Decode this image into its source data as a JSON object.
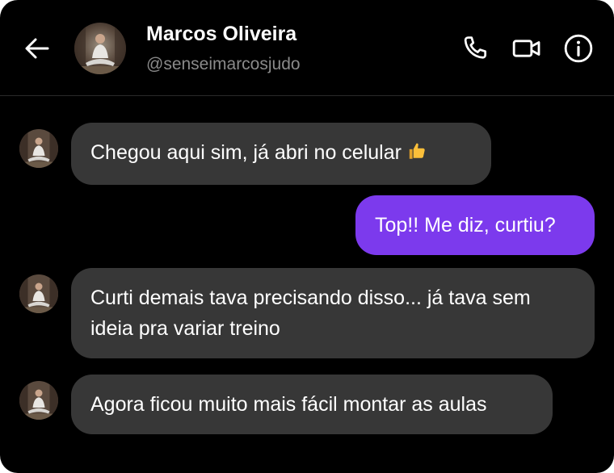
{
  "header": {
    "back_icon": "arrow-left-icon",
    "contact_name": "Marcos Oliveira",
    "contact_handle": "@senseimarcosjudo",
    "avatar": "avatar-photo-meditating-person",
    "actions": [
      {
        "icon": "phone-icon"
      },
      {
        "icon": "video-camera-icon"
      },
      {
        "icon": "info-icon"
      }
    ]
  },
  "messages": [
    {
      "direction": "incoming",
      "text": "Chegou aqui sim, já abri no celular",
      "emoji": "thumbs-up"
    },
    {
      "direction": "outgoing",
      "text": "Top!! Me diz, curtiu?"
    },
    {
      "direction": "incoming",
      "text": "Curti demais tava precisando disso... já tava sem ideia pra variar treino"
    },
    {
      "direction": "incoming",
      "text": "Agora ficou muito mais fácil montar as aulas"
    }
  ],
  "colors": {
    "background": "#000000",
    "incoming_bubble": "#373737",
    "outgoing_bubble": "#7c3aed",
    "text": "#ffffff",
    "handle_text": "#8a8a8a"
  }
}
